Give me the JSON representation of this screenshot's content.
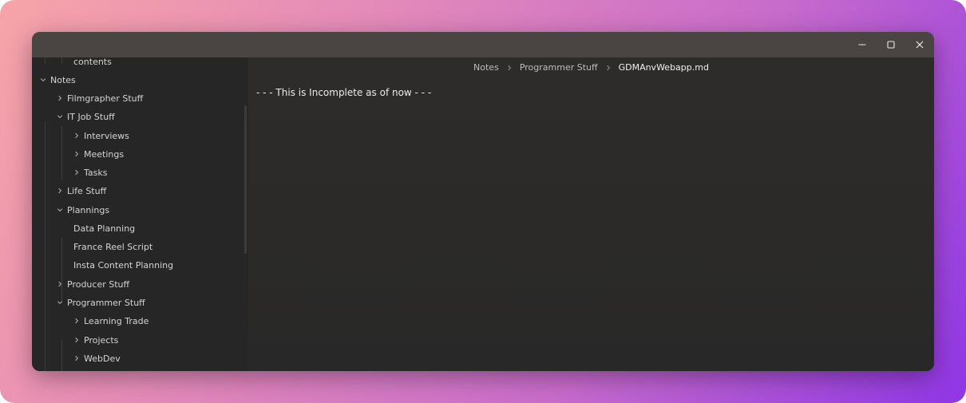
{
  "window": {
    "controls": {
      "minimize": "minimize-icon",
      "maximize": "maximize-icon",
      "close": "close-icon"
    }
  },
  "sidebar": {
    "items": [
      {
        "label": "contents",
        "caret": "none"
      },
      {
        "label": "Notes",
        "caret": "chevron-down"
      },
      {
        "label": "Filmgrapher Stuff",
        "caret": "chevron-right"
      },
      {
        "label": "IT Job Stuff",
        "caret": "chevron-down"
      },
      {
        "label": "Interviews",
        "caret": "chevron-right"
      },
      {
        "label": "Meetings",
        "caret": "chevron-right"
      },
      {
        "label": "Tasks",
        "caret": "chevron-right"
      },
      {
        "label": "Life Stuff",
        "caret": "chevron-right"
      },
      {
        "label": "Plannings",
        "caret": "chevron-down"
      },
      {
        "label": "Data Planning",
        "caret": "none"
      },
      {
        "label": "France Reel Script",
        "caret": "none"
      },
      {
        "label": "Insta Content Planning",
        "caret": "none"
      },
      {
        "label": "Producer Stuff",
        "caret": "chevron-right"
      },
      {
        "label": "Programmer Stuff",
        "caret": "chevron-down"
      },
      {
        "label": "Learning Trade",
        "caret": "chevron-right"
      },
      {
        "label": "Projects",
        "caret": "chevron-right"
      },
      {
        "label": "WebDev",
        "caret": "chevron-right"
      }
    ]
  },
  "breadcrumb": {
    "items": [
      "Notes",
      "Programmer Stuff",
      "GDMAnvWebapp.md"
    ]
  },
  "editor": {
    "text": "- - - This is Incomplete as of now - - -"
  },
  "colors": {
    "titlebar": "#4a4542",
    "sidebar_bg": "#262626",
    "editor_bg": "#2b2a29",
    "text": "#d4d4d4"
  }
}
